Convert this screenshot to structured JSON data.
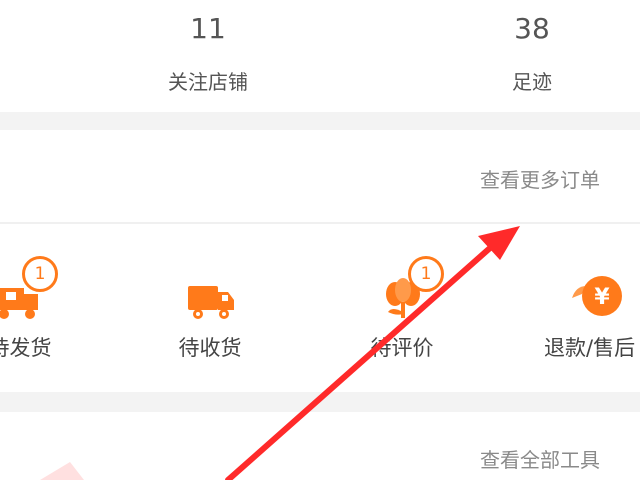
{
  "stats": {
    "followed_shops_count": "11",
    "followed_shops_label": "关注店铺",
    "footprints_count": "38",
    "footprints_label": "足迹"
  },
  "orders": {
    "view_more_label": "查看更多订单",
    "statuses": [
      {
        "label": "待发货",
        "icon": "box-truck-icon",
        "badge": "1"
      },
      {
        "label": "待收货",
        "icon": "truck-icon",
        "badge": ""
      },
      {
        "label": "待评价",
        "icon": "flower-review-icon",
        "badge": "1"
      },
      {
        "label": "退款/售后",
        "icon": "refund-yen-icon",
        "badge": ""
      }
    ]
  },
  "tools": {
    "view_all_label": "查看全部工具"
  },
  "colors": {
    "accent": "#ff7a1a",
    "arrow": "#ff2a2a",
    "section_gap": "#f3f3f3"
  }
}
